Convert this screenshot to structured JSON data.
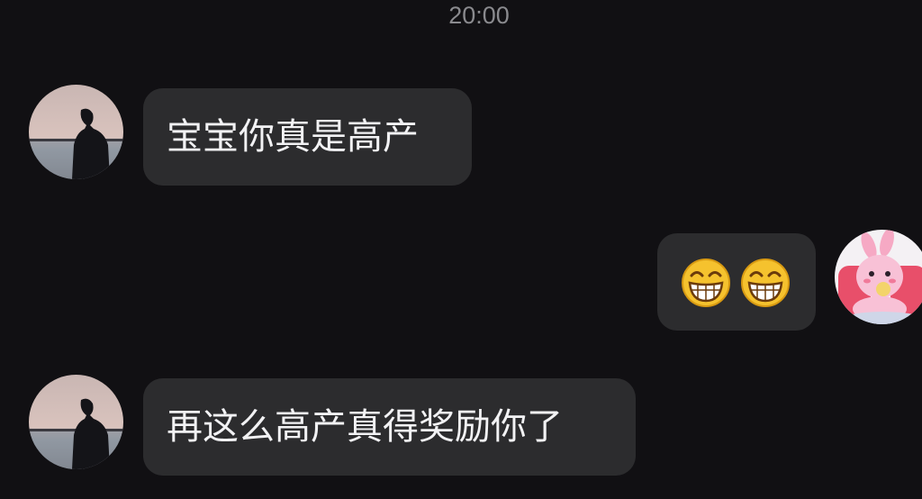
{
  "chat": {
    "timestamp": "20:00",
    "messages": [
      {
        "side": "left",
        "text": "宝宝你真是高产"
      },
      {
        "side": "right",
        "emojis": [
          "grinning-squint-emoji",
          "grinning-squint-emoji"
        ]
      },
      {
        "side": "left",
        "text": "再这么高产真得奖励你了"
      }
    ]
  },
  "colors": {
    "background": "#111013",
    "bubble": "#2c2c2e",
    "text": "#f2f2f4",
    "timestamp": "#8a8a8e",
    "emoji_face": "#f5c22e"
  }
}
